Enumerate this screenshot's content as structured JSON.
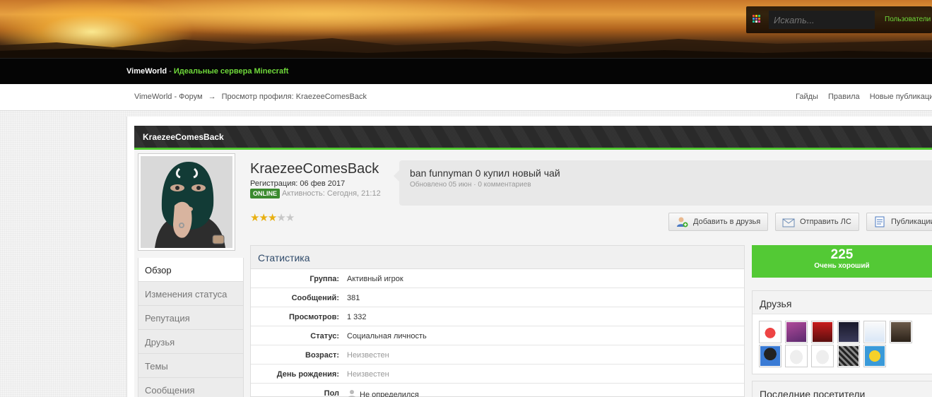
{
  "search": {
    "placeholder": "Искать...",
    "users_link": "Пользователи"
  },
  "site": {
    "brand": "VimeWorld",
    "separator": " - ",
    "tagline": "Идеальные сервера Minecraft"
  },
  "breadcrumb": {
    "home": "VimeWorld - Форум",
    "arrow": "→",
    "current": "Просмотр профиля: KraezeeComesBack"
  },
  "top_nav": [
    "Гайды",
    "Правила",
    "Новые публикации"
  ],
  "profile": {
    "title": "KraezeeComesBack",
    "username": "KraezeeComesBack",
    "registration": "Регистрация: 06 фев 2017",
    "online_badge": "ONLINE",
    "activity": "Активность: Сегодня, 21:12",
    "rating_stars": 3,
    "rating_max": 5
  },
  "status_update": {
    "text": "ban funnyman 0 купил новый чай",
    "meta": "Обновлено 05 июн · 0 комментариев"
  },
  "actions": [
    "Добавить в друзья",
    "Отправить ЛС",
    "Публикации"
  ],
  "profile_nav": [
    {
      "label": "Обзор",
      "active": true
    },
    {
      "label": "Изменения статуса",
      "active": false
    },
    {
      "label": "Репутация",
      "active": false
    },
    {
      "label": "Друзья",
      "active": false
    },
    {
      "label": "Темы",
      "active": false
    },
    {
      "label": "Сообщения",
      "active": false
    }
  ],
  "stats": {
    "heading": "Статистика",
    "rows": [
      {
        "key": "Группа:",
        "value": "Активный игрок"
      },
      {
        "key": "Сообщений:",
        "value": "381"
      },
      {
        "key": "Просмотров:",
        "value": "1 332"
      },
      {
        "key": "Статус:",
        "value": "Социальная личность"
      },
      {
        "key": "Возраст:",
        "value": "Неизвестен"
      },
      {
        "key": "День рождения:",
        "value": "Неизвестен"
      },
      {
        "key": "Пол",
        "value": "Не определился"
      }
    ]
  },
  "reputation": {
    "value": "225",
    "label": "Очень хороший",
    "color": "#53c935"
  },
  "friends": {
    "heading": "Друзья",
    "count_shown": 12
  },
  "visitors": {
    "heading": "Последние посетители"
  },
  "colors": {
    "accent_green": "#4fc72e",
    "link_green": "#6fd93a",
    "online_badge": "#3b8a2f"
  }
}
